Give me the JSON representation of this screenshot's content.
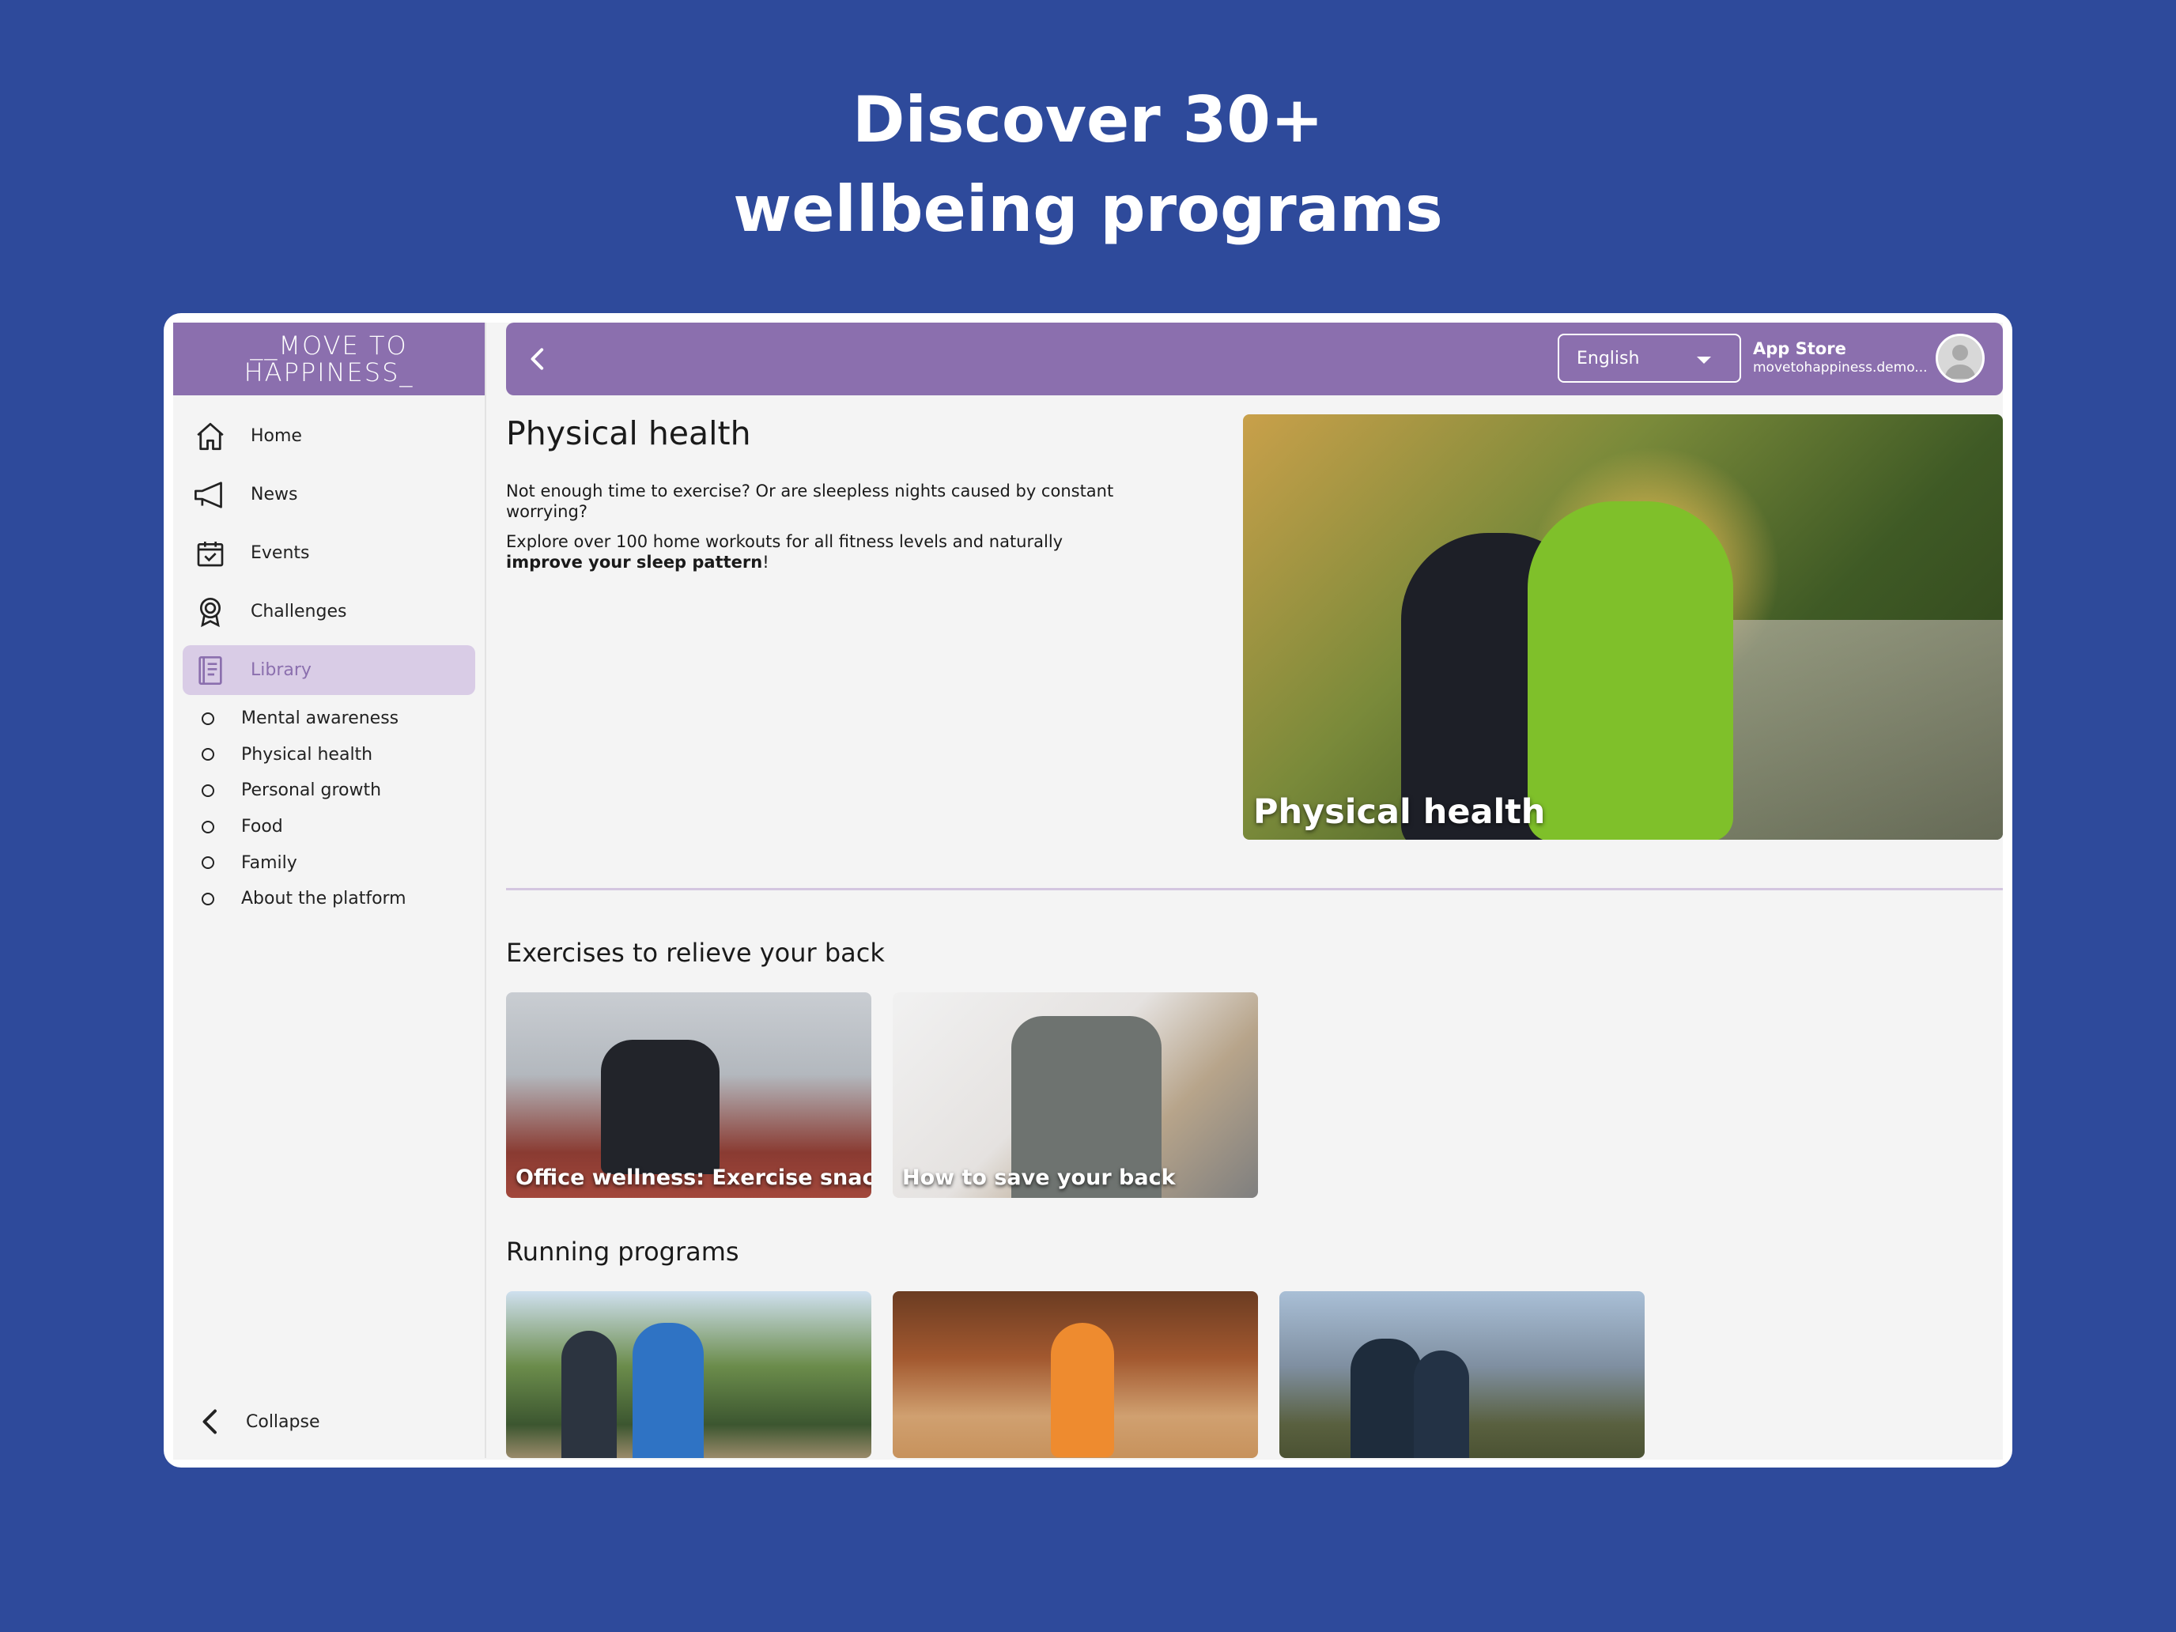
{
  "headline": {
    "line1": "Discover 30+",
    "line2": "wellbeing programs"
  },
  "brand": {
    "logo_line1": "__MOVE TO",
    "logo_line2": "HAPPINESS_",
    "accent": "#8b6fae",
    "background": "#2e4a9b"
  },
  "sidebar": {
    "items": [
      {
        "label": "Home",
        "icon": "home-icon"
      },
      {
        "label": "News",
        "icon": "megaphone-icon"
      },
      {
        "label": "Events",
        "icon": "calendar-check-icon"
      },
      {
        "label": "Challenges",
        "icon": "award-icon"
      },
      {
        "label": "Library",
        "icon": "book-icon",
        "active": true
      }
    ],
    "library_sections": [
      "Mental awareness",
      "Physical health",
      "Personal growth",
      "Food",
      "Family",
      "About the platform"
    ],
    "collapse_label": "Collapse"
  },
  "topbar": {
    "language": "English",
    "user_name": "App Store",
    "user_email": "movetohappiness.demo..."
  },
  "page": {
    "title": "Physical health",
    "desc1": "Not enough time to exercise? Or are sleepless nights caused by constant worrying?",
    "desc2_plain": "Explore over 100 home workouts for all fitness levels and naturally",
    "desc2_bold": "improve your sleep pattern",
    "desc2_end": "!",
    "hero_caption": "Physical health"
  },
  "sections": [
    {
      "title": "Exercises to relieve your back",
      "cards": [
        "Office wellness: Exercise snacks",
        "How to save your back"
      ]
    },
    {
      "title": "Running programs",
      "cards": [
        "",
        "",
        ""
      ]
    }
  ]
}
